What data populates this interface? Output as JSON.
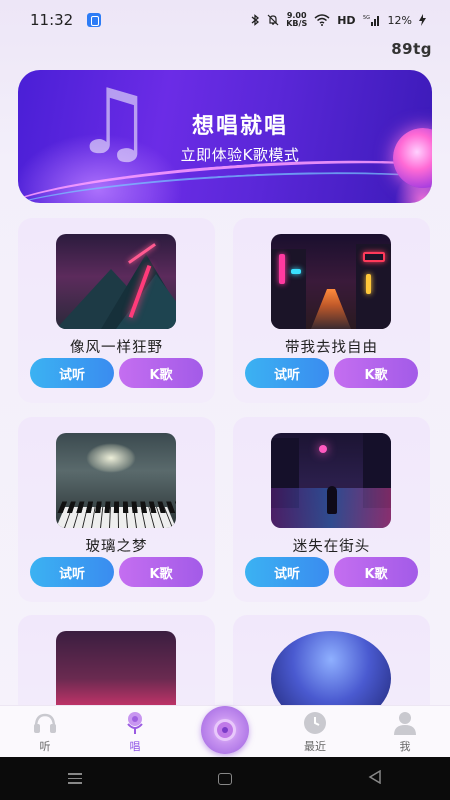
{
  "status_bar": {
    "time": "11:32",
    "net_speed_value": "9.00",
    "net_speed_unit": "KB/S",
    "network": "HD",
    "battery": "12%"
  },
  "app_code": "89tg",
  "banner": {
    "title": "想唱就唱",
    "subtitle": "立即体验K歌模式"
  },
  "songs": [
    {
      "title": "像风一样狂野",
      "listen_label": "试听",
      "karaoke_label": "K歌"
    },
    {
      "title": "带我去找自由",
      "listen_label": "试听",
      "karaoke_label": "K歌"
    },
    {
      "title": "玻璃之梦",
      "listen_label": "试听",
      "karaoke_label": "K歌"
    },
    {
      "title": "迷失在街头",
      "listen_label": "试听",
      "karaoke_label": "K歌"
    }
  ],
  "bottom_nav": [
    {
      "label": "听",
      "icon": "headphones-icon"
    },
    {
      "label": "唱",
      "icon": "microphone-icon"
    },
    {
      "label": "",
      "icon": "vinyl-disc-icon"
    },
    {
      "label": "最近",
      "icon": "clock-icon"
    },
    {
      "label": "我",
      "icon": "user-icon"
    }
  ],
  "colors": {
    "listen_button": "#3a9cf1",
    "karaoke_button": "#b466ec",
    "active_nav": "#8e55e6"
  }
}
